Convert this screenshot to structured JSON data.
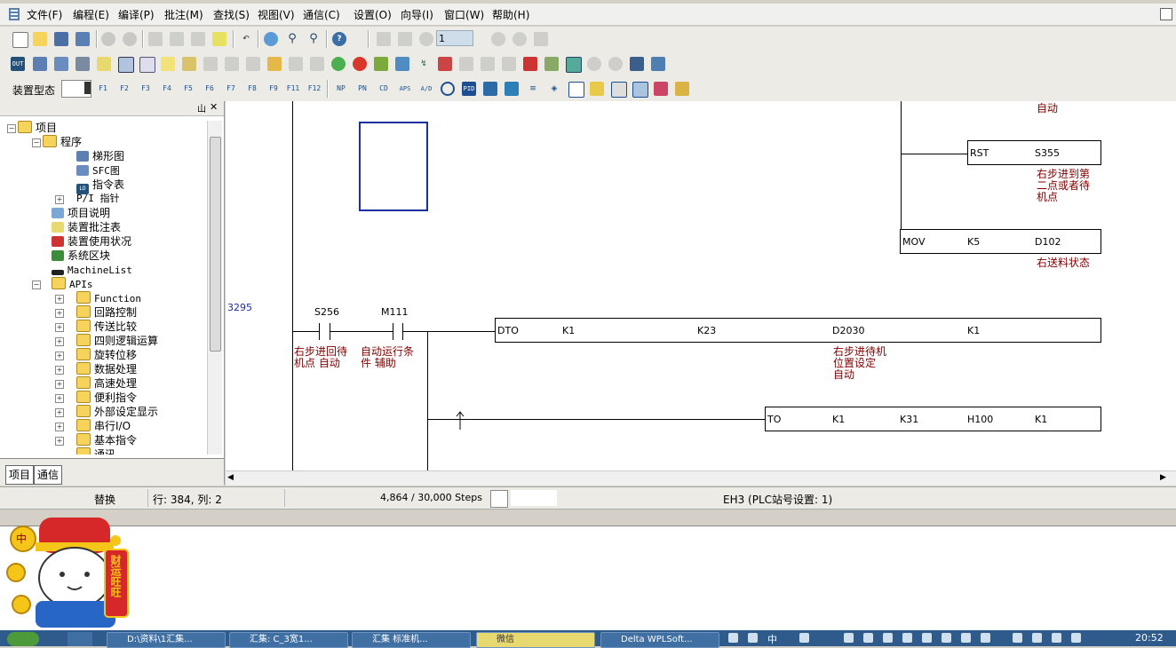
{
  "menu": {
    "items": [
      "文件(F)",
      "编程(E)",
      "编译(P)",
      "批注(M)",
      "查找(S)",
      "视图(V)",
      "通信(C)",
      "设置(O)",
      "向导(I)",
      "窗口(W)",
      "帮助(H)"
    ]
  },
  "toolbar": {
    "step_input_value": "1",
    "device_type_label": "装置型态",
    "fkeys": [
      "F1",
      "F2",
      "F3",
      "F4",
      "F5",
      "F6",
      "F7",
      "F8",
      "F9",
      "F11",
      "F12"
    ],
    "special_labels": [
      "NP",
      "PN",
      "CD",
      "APS",
      "A/D",
      "PID"
    ]
  },
  "project_tree": {
    "root": "项目",
    "program": "程序",
    "program_children": [
      "梯形图",
      "SFC图",
      "指令表"
    ],
    "pi_pointer": "P/I 指针",
    "items": [
      "项目说明",
      "装置批注表",
      "装置使用状况",
      "系统区块",
      "MachineList",
      "APIs"
    ],
    "apis": [
      "Function",
      "回路控制",
      "传送比较",
      "四则逻辑运算",
      "旋转位移",
      "数据处理",
      "高速处理",
      "便利指令",
      "外部设定显示",
      "串行I/O",
      "基本指令",
      "通讯"
    ],
    "icon_labels": {
      "ld": "LD",
      "out": "OUT"
    },
    "tabs": [
      "项目",
      "通信"
    ],
    "header_buttons": [
      "山",
      "✕"
    ]
  },
  "ladder": {
    "step_number": "3295",
    "top_comment": "自动",
    "rst": {
      "op": "RST",
      "arg": "S355",
      "comment": [
        "右步进到第",
        "二点或者待",
        "机点"
      ]
    },
    "mov": {
      "op": "MOV",
      "args": [
        "K5",
        "D102"
      ],
      "comment": [
        "右送料状态"
      ]
    },
    "contacts": [
      {
        "name": "S256",
        "comment": [
          "右步进回待",
          "机点 自动"
        ]
      },
      {
        "name": "M111",
        "comment": [
          "自动运行条",
          "件 辅助"
        ]
      }
    ],
    "dto": {
      "op": "DTO",
      "args": [
        "K1",
        "K23",
        "D2030",
        "K1"
      ],
      "comment": [
        "右步进待机",
        "位置设定",
        "自动"
      ]
    },
    "to": {
      "op": "TO",
      "args": [
        "K1",
        "K31",
        "H100",
        "K1"
      ]
    }
  },
  "status": {
    "mode": "替换",
    "position": "行: 384, 列: 2",
    "steps": "4,864 / 30,000 Steps",
    "plc": "EH3 (PLC站号设置: 1)"
  },
  "mascot": {
    "medal": "中",
    "banner": "财运旺旺"
  },
  "taskbar": {
    "items": [
      "D:\\资料\\1汇集...",
      "汇集: C_3宽1...",
      "汇集 标准机...",
      "微信",
      "Delta WPLSoft..."
    ],
    "tray_ime": "中",
    "clock": "20:52"
  }
}
